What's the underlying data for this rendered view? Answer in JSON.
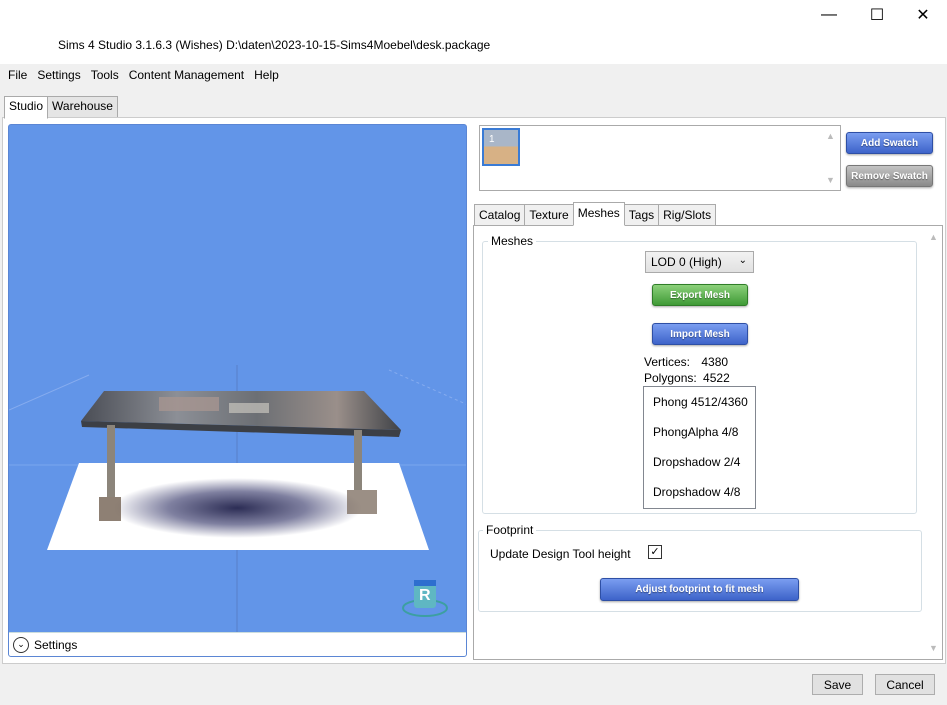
{
  "window": {
    "title": "Sims 4 Studio 3.1.6.3 (Wishes)  D:\\daten\\2023-10-15-Sims4Moebel\\desk.package",
    "controls": {
      "minimize": "—",
      "maximize": "☐",
      "close": "✕"
    }
  },
  "menu": {
    "items": [
      {
        "label": "File"
      },
      {
        "label": "Settings"
      },
      {
        "label": "Tools"
      },
      {
        "label": "Content Management"
      },
      {
        "label": "Help"
      }
    ]
  },
  "top_tabs": [
    {
      "label": "Studio",
      "active": true
    },
    {
      "label": "Warehouse",
      "active": false
    }
  ],
  "viewport": {
    "settings_label": "Settings",
    "chevron": "⌄",
    "badge": "R",
    "background": "#6295e8"
  },
  "swatches": {
    "items": [
      {
        "label": "1"
      }
    ],
    "add_label": "Add Swatch",
    "remove_label": "Remove Swatch"
  },
  "panel_tabs": [
    {
      "label": "Catalog",
      "active": false
    },
    {
      "label": "Texture",
      "active": false
    },
    {
      "label": "Meshes",
      "active": true
    },
    {
      "label": "Tags",
      "active": false
    },
    {
      "label": "Rig/Slots",
      "active": false
    }
  ],
  "meshes": {
    "group_label": "Meshes",
    "lod_selected": "LOD 0 (High)",
    "export_label": "Export Mesh",
    "import_label": "Import Mesh",
    "vertices_label": "Vertices:",
    "vertices_value": "4380",
    "polygons_label": "Polygons:",
    "polygons_value": "4522",
    "groups": [
      {
        "label": "Phong 4512/4360"
      },
      {
        "label": "PhongAlpha 4/8"
      },
      {
        "label": "Dropshadow 2/4"
      },
      {
        "label": "Dropshadow 4/8"
      }
    ]
  },
  "footprint": {
    "group_label": "Footprint",
    "update_label": "Update Design Tool height",
    "update_checked": true,
    "check_glyph": "✓",
    "adjust_label": "Adjust footprint to fit mesh"
  },
  "footer": {
    "save_label": "Save",
    "cancel_label": "Cancel"
  }
}
